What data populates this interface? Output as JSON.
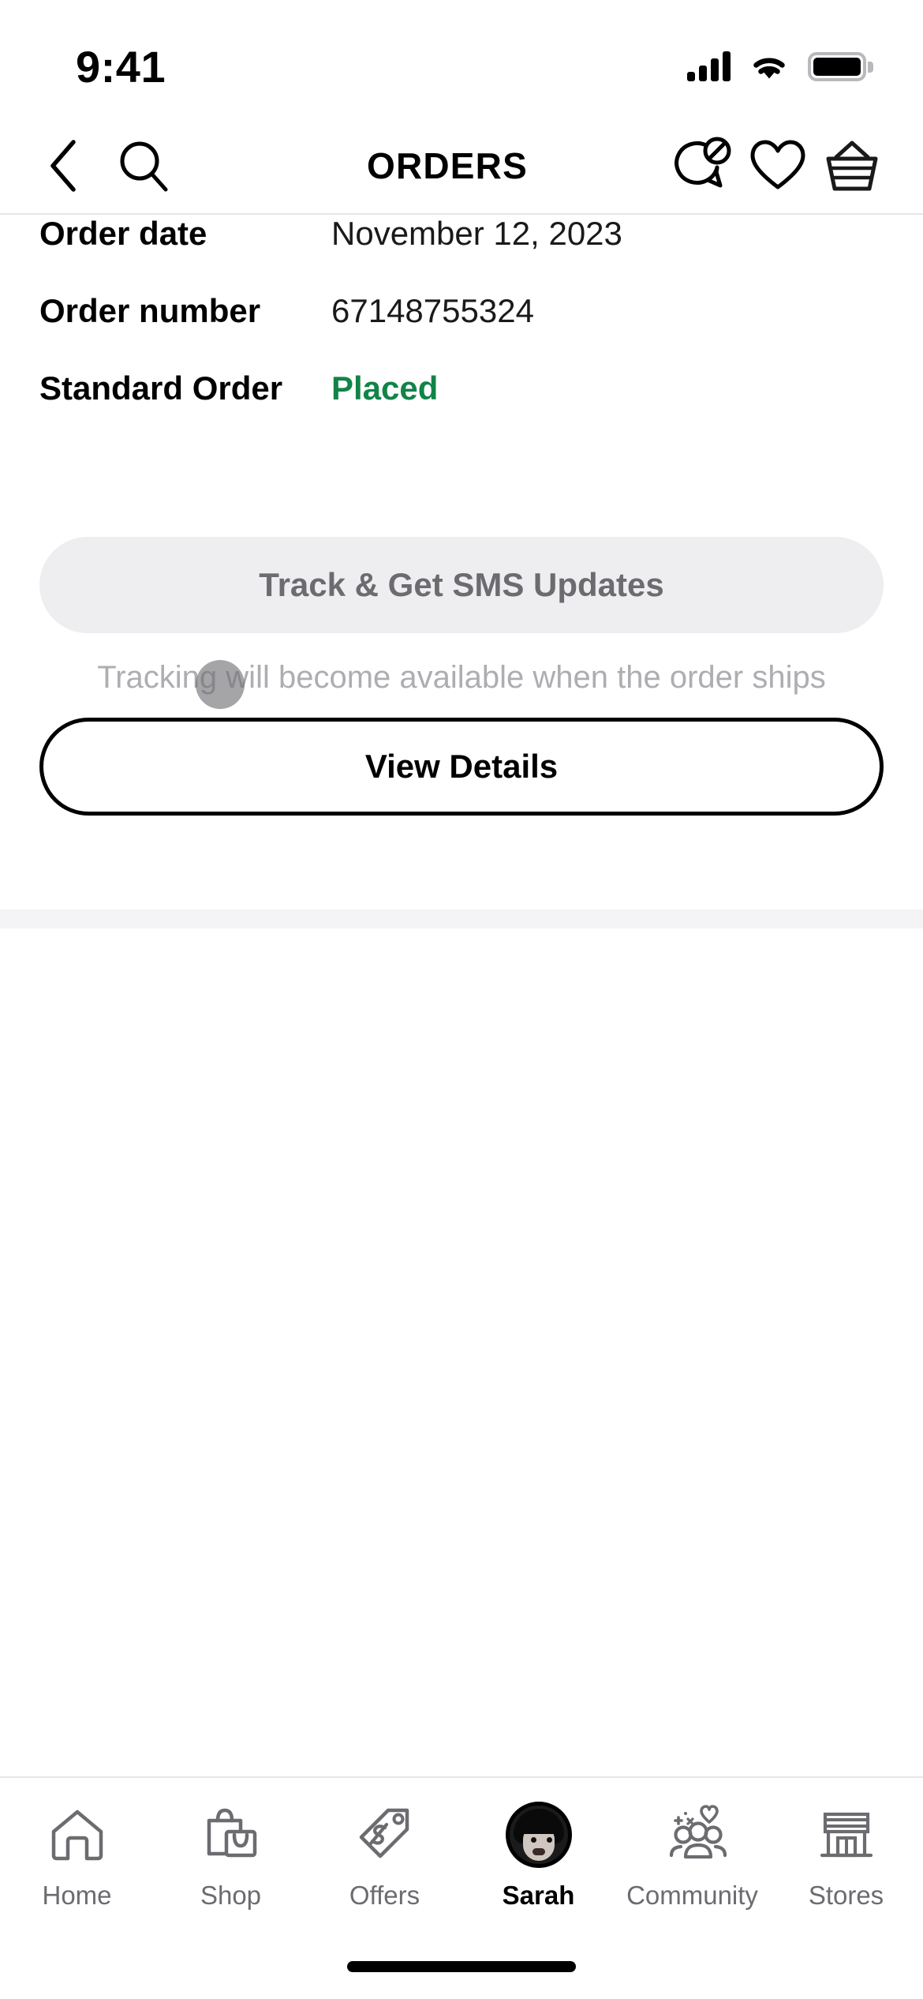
{
  "status_bar": {
    "time": "9:41",
    "signal_icon": "cellular-signal-icon",
    "wifi_icon": "wifi-icon",
    "battery_icon": "battery-icon"
  },
  "header": {
    "title": "ORDERS",
    "back_icon": "chevron-left-icon",
    "search_icon": "search-icon",
    "chat_icon": "chat-bubble-icon",
    "favorites_icon": "heart-icon",
    "basket_icon": "shopping-basket-icon"
  },
  "order": {
    "rows": [
      {
        "label": "Order date",
        "value": "November 12, 2023"
      },
      {
        "label": "Order number",
        "value": "67148755324"
      },
      {
        "label": "Standard Order",
        "value": "Placed"
      }
    ],
    "status_color": "#118448"
  },
  "actions": {
    "track_label": "Track & Get SMS Updates",
    "track_note": "Tracking will become available when the order ships",
    "details_label": "View Details"
  },
  "tabbar": {
    "items": [
      {
        "label": "Home",
        "icon": "home-icon",
        "active": false
      },
      {
        "label": "Shop",
        "icon": "shop-bags-icon",
        "active": false
      },
      {
        "label": "Offers",
        "icon": "price-tag-icon",
        "active": false
      },
      {
        "label": "Sarah",
        "icon": "avatar",
        "active": true
      },
      {
        "label": "Community",
        "icon": "community-icon",
        "active": false
      },
      {
        "label": "Stores",
        "icon": "storefront-icon",
        "active": false
      }
    ]
  },
  "colors": {
    "accent_green": "#118448",
    "muted_gray": "#6b6b70",
    "placeholder_gray": "#adadb2",
    "pill_bg": "#eeeef0",
    "separator": "#f4f4f6"
  }
}
